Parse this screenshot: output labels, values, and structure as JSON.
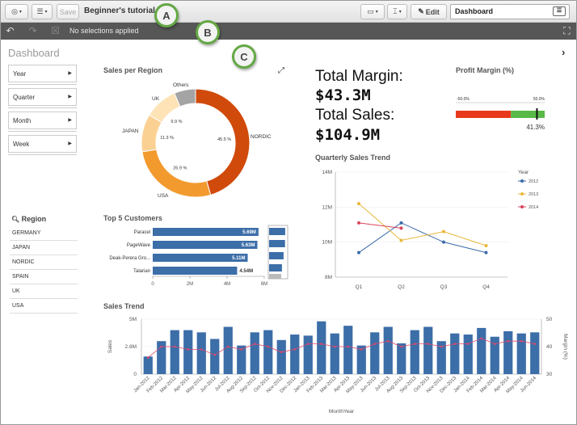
{
  "toolbar": {
    "save_label": "Save",
    "app_title": "Beginner's tutorial",
    "edit_label": "Edit",
    "sheet_name": "Dashboard"
  },
  "selections": {
    "status": "No selections applied"
  },
  "callouts": [
    "A",
    "B",
    "C"
  ],
  "sheet": {
    "title": "Dashboard"
  },
  "filters": [
    "Year",
    "Quarter",
    "Month",
    "Week"
  ],
  "region_list": {
    "title": "Region",
    "items": [
      "GERMANY",
      "JAPAN",
      "NORDIC",
      "SPAIN",
      "UK",
      "USA"
    ]
  },
  "kpi": {
    "margin_label": "Total Margin:",
    "margin_value": "$43.3M",
    "sales_label": "Total Sales:",
    "sales_value": "$104.9M"
  },
  "colors": {
    "nordic": "#d04a0b",
    "usa": "#f29a2e",
    "japan": "#fbd193",
    "uk": "#fde3b6",
    "others": "#a4a4a4",
    "bar": "#3c6ea8",
    "line": "#e0476b",
    "q2012": "#3a6ba8",
    "q2013": "#e8b83a",
    "q2014": "#d9435c",
    "gauge_red": "#e8391d",
    "gauge_green": "#58b947"
  },
  "charts": {
    "region_pie": {
      "type": "pie",
      "title": "Sales per Region",
      "slices": [
        {
          "label": "NORDIC",
          "pct_label": "45.5 %",
          "value": 45.5,
          "color": "#d04a0b"
        },
        {
          "label": "USA",
          "pct_label": "26.9 %",
          "value": 26.9,
          "color": "#f29a2e"
        },
        {
          "label": "JAPAN",
          "pct_label": "11.3 %",
          "value": 11.3,
          "color": "#fbd193"
        },
        {
          "label": "UK",
          "pct_label": "9.9 %",
          "value": 9.9,
          "color": "#fde3b6"
        },
        {
          "label": "Others",
          "pct_label": "",
          "value": 6.4,
          "color": "#a4a4a4"
        }
      ]
    },
    "top_customers": {
      "type": "bar",
      "title": "Top 5 Customers",
      "categories": [
        "Paracel",
        "PageWave",
        "Deak-Perera Gro...",
        "Talarian"
      ],
      "values": [
        5.69,
        5.63,
        5.11,
        4.54
      ],
      "value_labels": [
        "5.69M",
        "5.63M",
        "5.11M",
        "4.54M"
      ],
      "xticks": [
        "0",
        "2M",
        "4M",
        "6M"
      ],
      "xlim": [
        0,
        6
      ]
    },
    "profit_gauge": {
      "title": "Profit Margin (%)",
      "min_label": "-50.0%",
      "max_label": "50.0%",
      "value": 41.3,
      "value_label": "41.3%"
    },
    "quarterly": {
      "type": "line",
      "title": "Quarterly Sales Trend",
      "categories": [
        "Q1",
        "Q2",
        "Q3",
        "Q4"
      ],
      "yticks": [
        "8M",
        "10M",
        "12M",
        "14M"
      ],
      "ylim": [
        8,
        14
      ],
      "legend_title": "Year",
      "series": [
        {
          "name": "2012",
          "values": [
            9.4,
            11.1,
            10.0,
            9.4
          ],
          "color": "#3a6ba8"
        },
        {
          "name": "2013",
          "values": [
            12.2,
            10.1,
            10.6,
            9.8
          ],
          "color": "#e8b83a"
        },
        {
          "name": "2014",
          "values": [
            11.1,
            10.8
          ],
          "color": "#d9435c"
        }
      ]
    },
    "sales_trend": {
      "type": "bar",
      "title": "Sales Trend",
      "xlabel": "MonthYear",
      "ylabel": "Sales",
      "y2label": "Margin (%)",
      "categories": [
        "Jan-2012",
        "Feb-2012",
        "Mar-2012",
        "Apr-2012",
        "May-2012",
        "Jun-2012",
        "Jul-2012",
        "Aug-2012",
        "Sep-2012",
        "Oct-2012",
        "Nov-2012",
        "Dec-2012",
        "Jan-2013",
        "Feb-2013",
        "Mar-2013",
        "Apr-2013",
        "May-2013",
        "Jun-2013",
        "Jul-2013",
        "Aug-2013",
        "Sep-2013",
        "Oct-2013",
        "Nov-2013",
        "Dec-2013",
        "Jan-2014",
        "Feb-2014",
        "Mar-2014",
        "Apr-2014",
        "May-2014",
        "Jun-2014"
      ],
      "tick_labels": [
        "Jan-2012",
        "Feb-2012",
        "Mar-2012",
        "Apr-2012",
        "May-2012",
        "Jun-2012",
        "Jul-2012",
        "Aug-2012",
        "Sep-2012",
        "Oct-2012",
        "Nov-2012",
        "Dec-2012",
        "Jan-2013",
        "Feb-2013",
        "Mar-2013",
        "Apr-2013",
        "May-2013",
        "Jun-2013",
        "Jul-2013",
        "Aug-2013",
        "Sep-2013",
        "Oct-2013",
        "Nov-2013",
        "Dec-2013",
        "Jan-2014",
        "Feb-2014",
        "Mar-2014",
        "Apr-2014",
        "May-2014",
        "Jun-2014"
      ],
      "sales": [
        1.6,
        3.0,
        4.0,
        4.0,
        3.8,
        3.2,
        4.3,
        2.6,
        3.8,
        4.0,
        3.1,
        3.6,
        3.5,
        4.8,
        3.7,
        4.4,
        2.6,
        3.8,
        4.3,
        2.8,
        4.0,
        4.3,
        3.0,
        3.7,
        3.6,
        4.2,
        3.4,
        3.9,
        3.7,
        3.8
      ],
      "margin": [
        36,
        40,
        40,
        39,
        39,
        37,
        40,
        39,
        41,
        40,
        38,
        39,
        41,
        41,
        40,
        40,
        39,
        41,
        42,
        40,
        41,
        41,
        40,
        41,
        41,
        43,
        41,
        42,
        42,
        41
      ],
      "yticks": [
        "0",
        "2.8M",
        "5M"
      ],
      "y2ticks": [
        "30",
        "40",
        "50"
      ],
      "ylim": [
        0,
        5
      ],
      "y2lim": [
        30,
        50
      ]
    }
  }
}
